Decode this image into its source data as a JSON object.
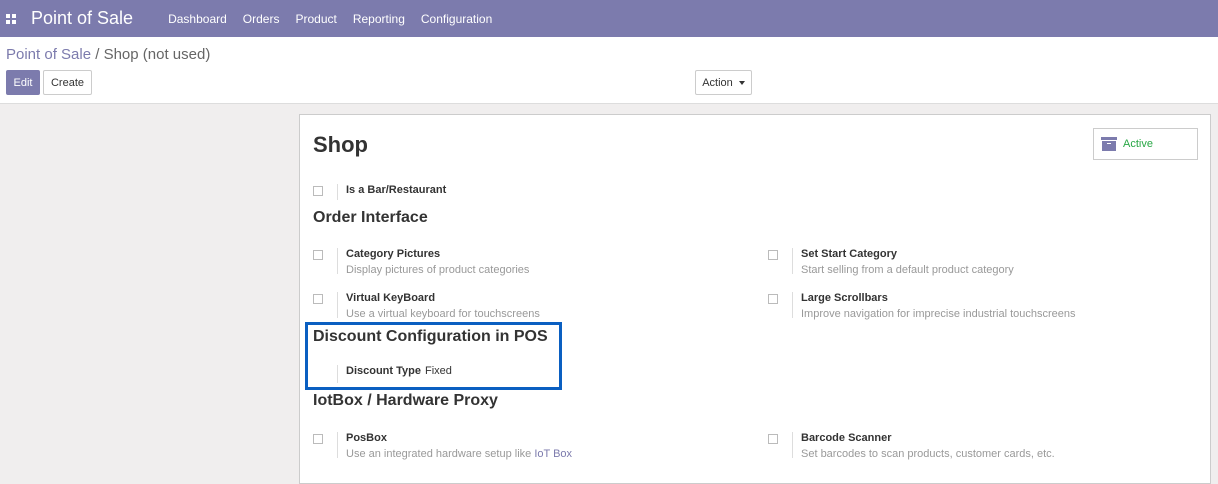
{
  "navbar": {
    "app_title": "Point of Sale",
    "menu": [
      "Dashboard",
      "Orders",
      "Product",
      "Reporting",
      "Configuration"
    ]
  },
  "breadcrumb": {
    "parent": "Point of Sale",
    "separator": "/",
    "current": "Shop (not used)"
  },
  "buttons": {
    "edit": "Edit",
    "create": "Create",
    "action": "Action"
  },
  "form": {
    "title": "Shop",
    "status": "Active",
    "is_bar": {
      "label": "Is a Bar/Restaurant"
    },
    "order_interface": {
      "title": "Order Interface",
      "settings": [
        {
          "label": "Category Pictures",
          "desc": "Display pictures of product categories"
        },
        {
          "label": "Set Start Category",
          "desc": "Start selling from a default product category"
        },
        {
          "label": "Virtual KeyBoard",
          "desc": "Use a virtual keyboard for touchscreens"
        },
        {
          "label": "Large Scrollbars",
          "desc": "Improve navigation for imprecise industrial touchscreens"
        }
      ]
    },
    "discount": {
      "title": "Discount Configuration in POS",
      "field_label": "Discount Type",
      "field_value": "Fixed"
    },
    "iotbox": {
      "title": "IotBox / Hardware Proxy",
      "settings": [
        {
          "label": "PosBox",
          "desc_prefix": "Use an integrated hardware setup like ",
          "desc_link": "IoT Box"
        },
        {
          "label": "Barcode Scanner",
          "desc": "Set barcodes to scan products, customer cards, etc."
        }
      ]
    }
  },
  "colors": {
    "brand": "#7c7bad",
    "active": "#28a745",
    "highlight": "#0a5fc1"
  }
}
